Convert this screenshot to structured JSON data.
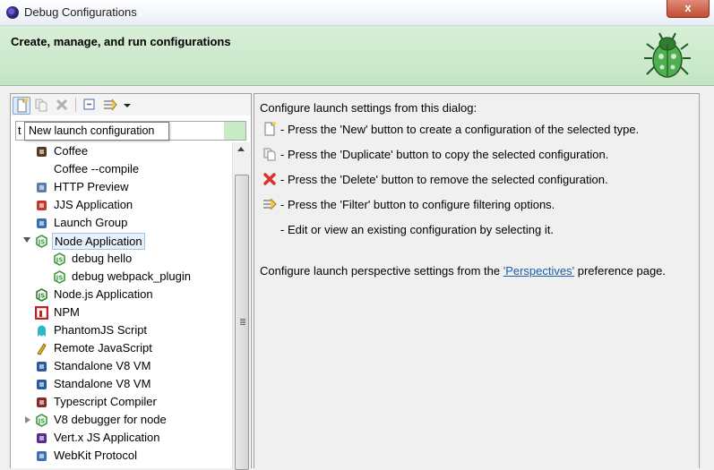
{
  "window": {
    "title": "Debug Configurations",
    "close_label": "x"
  },
  "header": {
    "title": "Create, manage, and run configurations"
  },
  "toolbar": {
    "buttons": [
      "new-icon",
      "duplicate-icon",
      "delete-icon",
      "collapse-all-icon",
      "filter-icon",
      "view-menu-icon"
    ]
  },
  "filter": {
    "value": "t"
  },
  "tooltip": {
    "text": "New launch configuration"
  },
  "tree": {
    "items": [
      {
        "label": "Coffee",
        "icon": "coffee-icon",
        "level": 0
      },
      {
        "label": "Coffee --compile",
        "icon": "",
        "level": 0
      },
      {
        "label": "HTTP Preview",
        "icon": "http-preview-icon",
        "level": 0
      },
      {
        "label": "JJS Application",
        "icon": "jjs-icon",
        "level": 0
      },
      {
        "label": "Launch Group",
        "icon": "launch-group-icon",
        "level": 0
      },
      {
        "label": "Node Application",
        "icon": "node-icon",
        "level": 0,
        "expanded": true,
        "selected": true
      },
      {
        "label": "debug hello",
        "icon": "node-icon",
        "level": 1
      },
      {
        "label": "debug webpack_plugin",
        "icon": "node-icon",
        "level": 1
      },
      {
        "label": "Node.js Application",
        "icon": "nodejs-icon",
        "level": 0
      },
      {
        "label": "NPM",
        "icon": "npm-icon",
        "level": 0
      },
      {
        "label": "PhantomJS Script",
        "icon": "phantomjs-icon",
        "level": 0
      },
      {
        "label": "Remote JavaScript",
        "icon": "remote-js-icon",
        "level": 0
      },
      {
        "label": "Standalone V8 VM",
        "icon": "v8-icon",
        "level": 0
      },
      {
        "label": "Standalone V8 VM",
        "icon": "v8-icon",
        "level": 0
      },
      {
        "label": "Typescript Compiler",
        "icon": "typescript-icon",
        "level": 0
      },
      {
        "label": "V8 debugger for node",
        "icon": "node-icon",
        "level": 0,
        "collapsed": true
      },
      {
        "label": "Vert.x JS Application",
        "icon": "vertx-icon",
        "level": 0
      },
      {
        "label": "WebKit Protocol",
        "icon": "webkit-icon",
        "level": 0
      }
    ]
  },
  "right": {
    "intro": "Configure launch settings from this dialog:",
    "lines": [
      {
        "icon": "new-icon",
        "text": "- Press the 'New' button to create a configuration of the selected type."
      },
      {
        "icon": "duplicate-icon",
        "text": "- Press the 'Duplicate' button to copy the selected configuration."
      },
      {
        "icon": "delete-icon",
        "text": "- Press the 'Delete' button to remove the selected configuration."
      },
      {
        "icon": "filter-icon",
        "text": "- Press the 'Filter' button to configure filtering options."
      },
      {
        "icon": "",
        "text": "- Edit or view an existing configuration by selecting it."
      }
    ],
    "perspective_prefix": "Configure launch perspective settings from the",
    "perspective_link": "'Perspectives'",
    "perspective_suffix": "preference page."
  },
  "colors": {
    "header_bg": "#c9e8c9",
    "selection": "#e6f1fc",
    "link": "#1a5ea8",
    "close": "#c24c34"
  }
}
